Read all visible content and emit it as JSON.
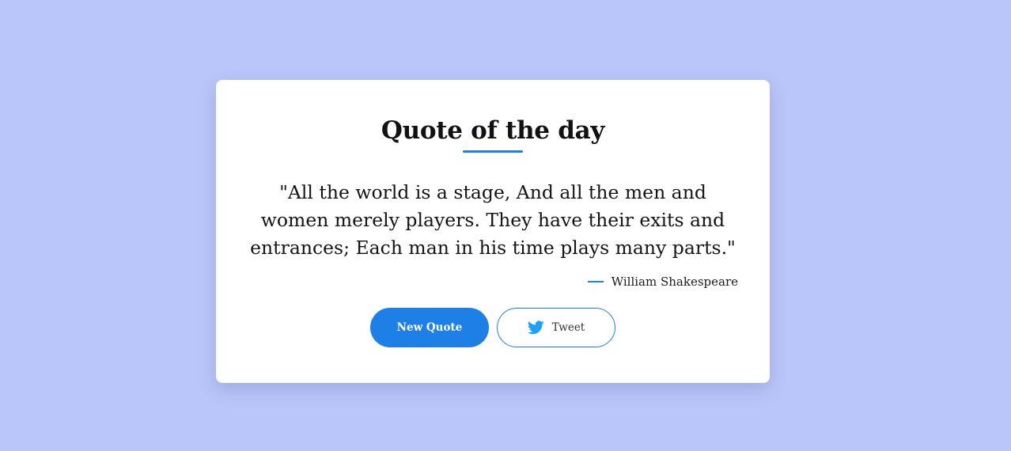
{
  "colors": {
    "background": "#bac6f9",
    "card": "#ffffff",
    "accent": "#1e7fe6",
    "twitter": "#1da1f2"
  },
  "card": {
    "title": "Quote of the day",
    "quote": "\"All the world is a stage, And all the men and women merely players. They have their exits and entrances; Each man in his time plays many parts.\"",
    "author": "William Shakespeare"
  },
  "buttons": {
    "new_quote_label": "New Quote",
    "tweet_label": "Tweet",
    "tweet_icon": "twitter-bird-icon"
  }
}
